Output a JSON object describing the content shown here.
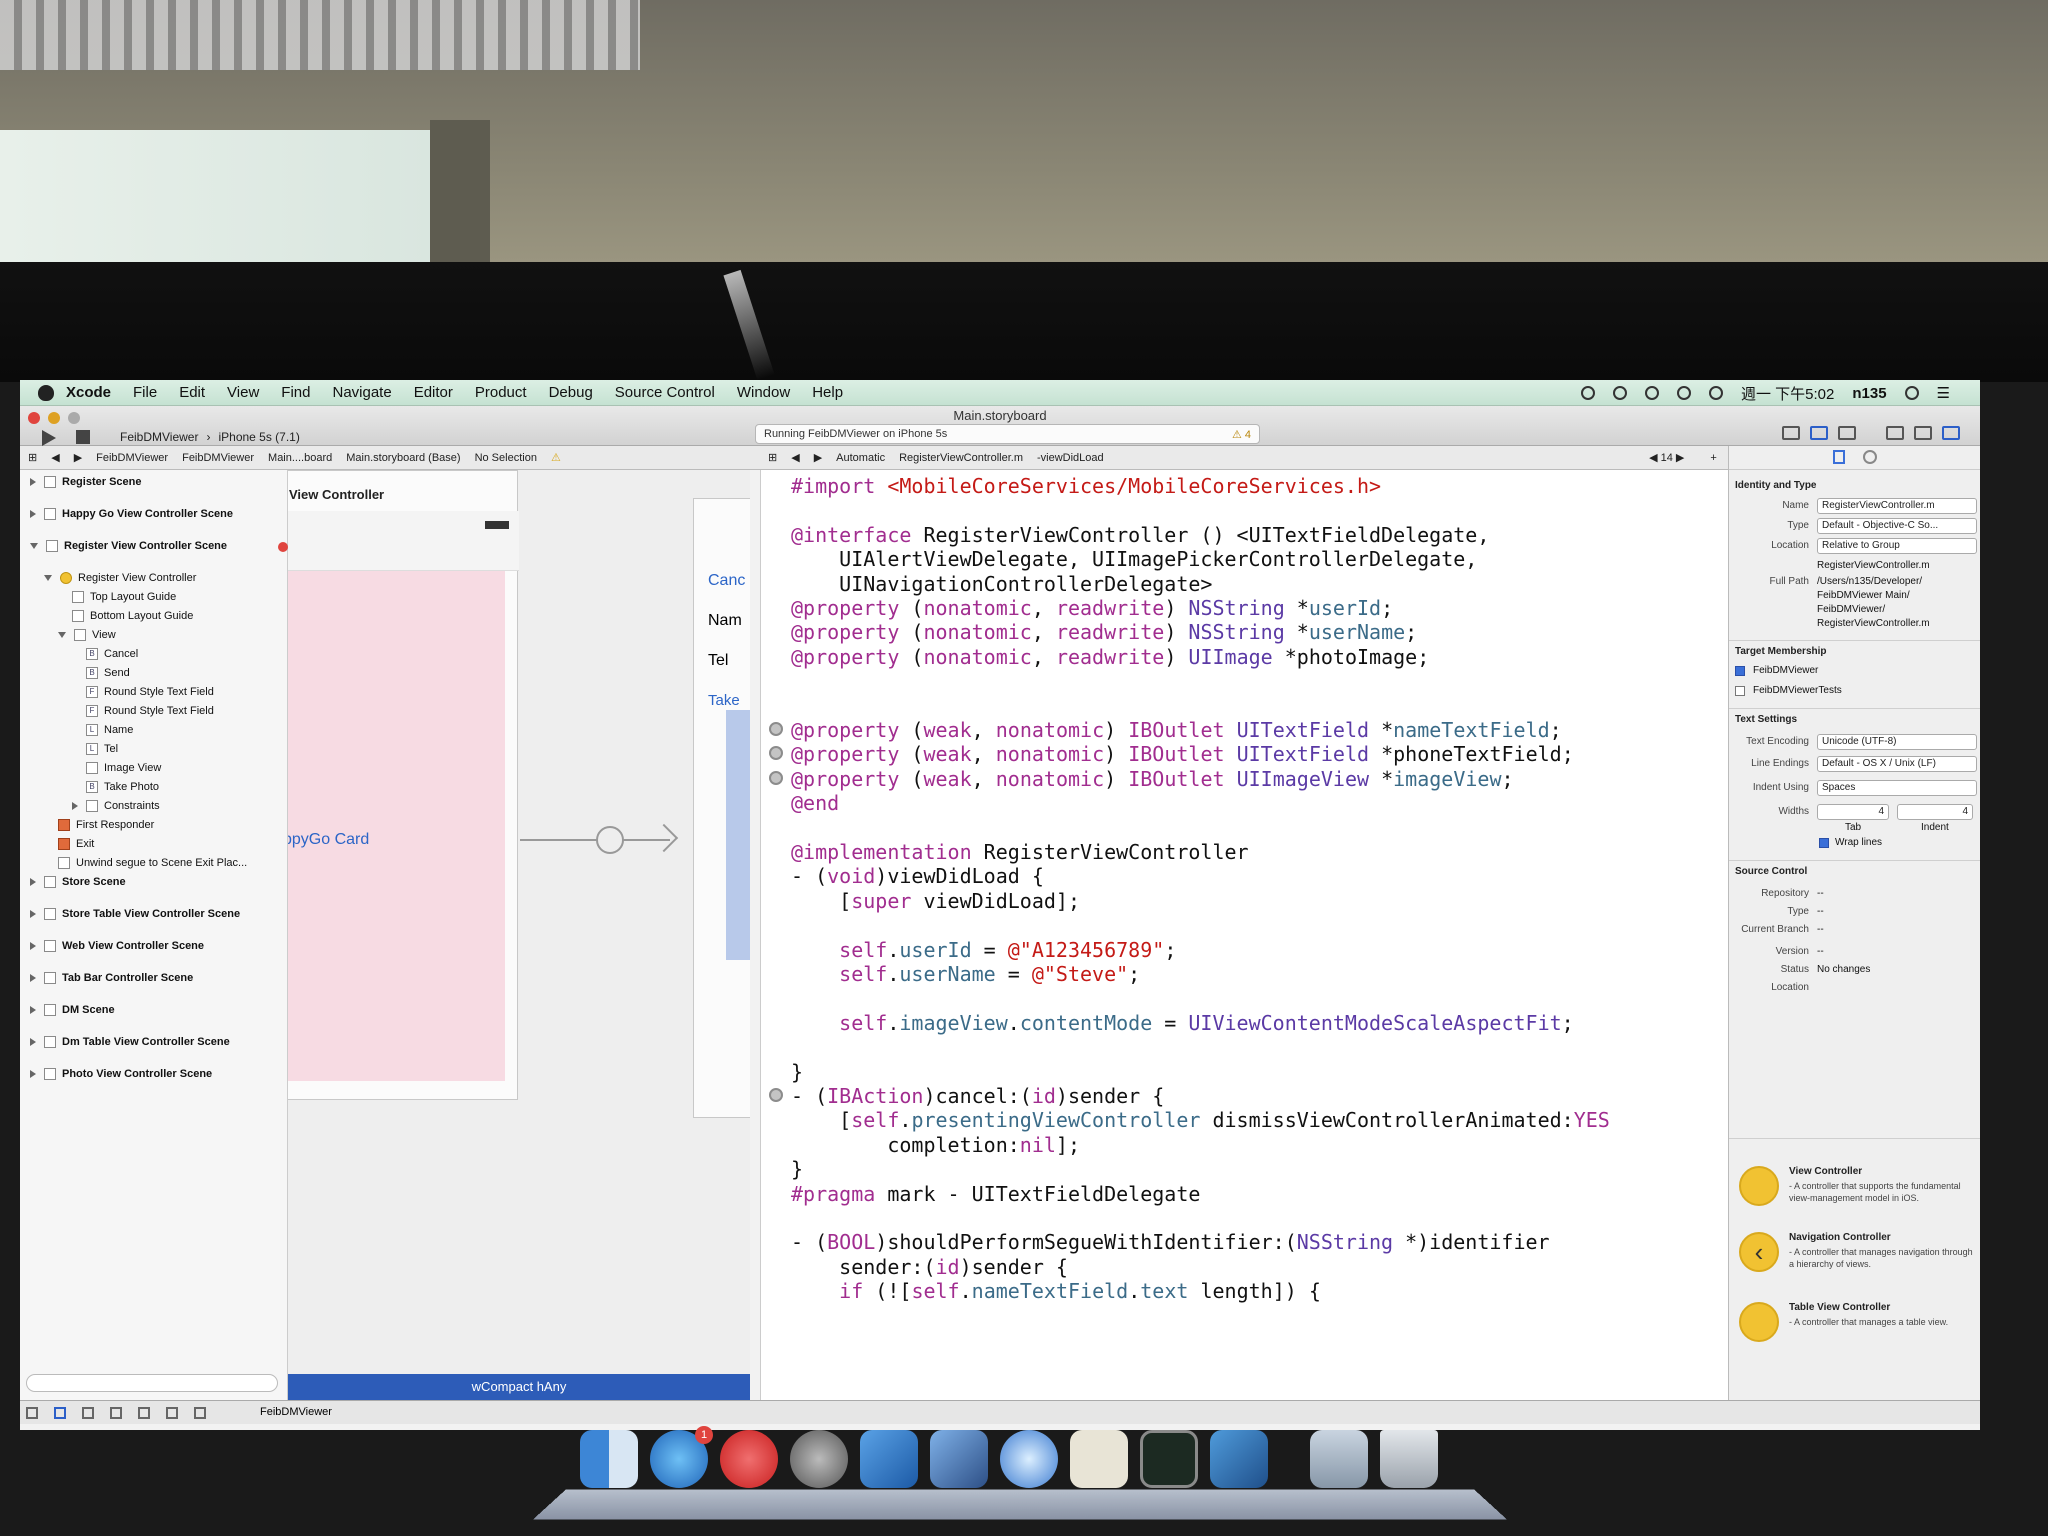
{
  "menubar": {
    "app": "Xcode",
    "items": [
      "File",
      "Edit",
      "View",
      "Find",
      "Navigate",
      "Editor",
      "Product",
      "Debug",
      "Source Control",
      "Window",
      "Help"
    ],
    "clock": "週一 下午5:02",
    "user": "n135"
  },
  "toolbar": {
    "window_title": "Main.storyboard",
    "scheme": "FeibDMViewer",
    "device": "iPhone 5s (7.1)",
    "activity": "Running FeibDMViewer on iPhone 5s",
    "warnings": "4"
  },
  "jumpbar_left": {
    "items": [
      "FeibDMViewer",
      "FeibDMViewer",
      "Main....board",
      "Main.storyboard (Base)",
      "No Selection"
    ]
  },
  "jumpbar_right": {
    "mode": "Automatic",
    "file": "RegisterViewController.m",
    "method": "-viewDidLoad",
    "counter": "14"
  },
  "navigator": {
    "rows": [
      {
        "label": "Register Scene",
        "level": 0,
        "scene": true
      },
      {
        "label": "Happy Go View Controller Scene",
        "level": 0,
        "scene": true
      },
      {
        "label": "Register View Controller Scene",
        "level": 0,
        "scene": true,
        "open": true,
        "error": true
      },
      {
        "label": "Register View Controller",
        "level": 1,
        "icon": "yellow",
        "open": true
      },
      {
        "label": "Top Layout Guide",
        "level": 2
      },
      {
        "label": "Bottom Layout Guide",
        "level": 2
      },
      {
        "label": "View",
        "level": 2,
        "open": true
      },
      {
        "label": "Cancel",
        "level": 3,
        "glyph": "B"
      },
      {
        "label": "Send",
        "level": 3,
        "glyph": "B"
      },
      {
        "label": "Round Style Text Field",
        "level": 3,
        "glyph": "F"
      },
      {
        "label": "Round Style Text Field",
        "level": 3,
        "glyph": "F"
      },
      {
        "label": "Name",
        "level": 3,
        "glyph": "L"
      },
      {
        "label": "Tel",
        "level": 3,
        "glyph": "L"
      },
      {
        "label": "Image View",
        "level": 3
      },
      {
        "label": "Take Photo",
        "level": 3,
        "glyph": "B"
      },
      {
        "label": "Constraints",
        "level": 3,
        "closed": true
      },
      {
        "label": "First Responder",
        "level": 1,
        "icon": "orange"
      },
      {
        "label": "Exit",
        "level": 1,
        "icon": "orange"
      },
      {
        "label": "Unwind segue to Scene Exit Plac...",
        "level": 1
      },
      {
        "label": "Store Scene",
        "level": 0,
        "scene": true
      },
      {
        "label": "Store Table View Controller Scene",
        "level": 0,
        "scene": true
      },
      {
        "label": "Web View Controller Scene",
        "level": 0,
        "scene": true
      },
      {
        "label": "Tab Bar Controller Scene",
        "level": 0,
        "scene": true
      },
      {
        "label": "DM Scene",
        "level": 0,
        "scene": true
      },
      {
        "label": "Dm Table View Controller Scene",
        "level": 0,
        "scene": true
      },
      {
        "label": "Photo View Controller Scene",
        "level": 0,
        "scene": true
      }
    ]
  },
  "canvas": {
    "vc_title": "View Controller",
    "happygo_label": "ppyGo Card",
    "vc2_cancel": "Canc",
    "vc2_name": "Nam",
    "vc2_tel": "Tel",
    "vc2_take": "Take",
    "size_class": "wCompact hAny"
  },
  "code": {
    "lines": [
      {
        "t": "#import <MobileCoreServices/MobileCoreServices.h>"
      },
      {
        "t": ""
      },
      {
        "t": "@interface RegisterViewController () <UITextFieldDelegate,"
      },
      {
        "t": "    UIAlertViewDelegate, UIImagePickerControllerDelegate,"
      },
      {
        "t": "    UINavigationControllerDelegate>"
      },
      {
        "t": "@property (nonatomic, readwrite) NSString *userId;"
      },
      {
        "t": "@property (nonatomic, readwrite) NSString *userName;"
      },
      {
        "t": "@property (nonatomic, readwrite) UIImage *photoImage;"
      },
      {
        "t": ""
      },
      {
        "t": ""
      },
      {
        "t": "@property (weak, nonatomic) IBOutlet UITextField *nameTextField;",
        "dot": true
      },
      {
        "t": "@property (weak, nonatomic) IBOutlet UITextField *phoneTextField;",
        "dot": true
      },
      {
        "t": "@property (weak, nonatomic) IBOutlet UIImageView *imageView;",
        "dot": true
      },
      {
        "t": "@end"
      },
      {
        "t": ""
      },
      {
        "t": "@implementation RegisterViewController"
      },
      {
        "t": "- (void)viewDidLoad {"
      },
      {
        "t": "    [super viewDidLoad];"
      },
      {
        "t": ""
      },
      {
        "t": "    self.userId = @\"A123456789\";"
      },
      {
        "t": "    self.userName = @\"Steve\";"
      },
      {
        "t": ""
      },
      {
        "t": "    self.imageView.contentMode = UIViewContentModeScaleAspectFit;"
      },
      {
        "t": ""
      },
      {
        "t": "}"
      },
      {
        "t": "- (IBAction)cancel:(id)sender {",
        "dot": true
      },
      {
        "t": "    [self.presentingViewController dismissViewControllerAnimated:YES"
      },
      {
        "t": "        completion:nil];"
      },
      {
        "t": "}"
      },
      {
        "t": "#pragma mark - UITextFieldDelegate"
      },
      {
        "t": ""
      },
      {
        "t": "- (BOOL)shouldPerformSegueWithIdentifier:(NSString *)identifier"
      },
      {
        "t": "    sender:(id)sender {"
      },
      {
        "t": "    if (![self.nameTextField.text length]) {"
      }
    ]
  },
  "inspector": {
    "identity_header": "Identity and Type",
    "name_label": "Name",
    "name_value": "RegisterViewController.m",
    "type_label": "Type",
    "type_value": "Default - Objective-C So...",
    "location_label": "Location",
    "location_value": "Relative to Group",
    "location_file": "RegisterViewController.m",
    "fullpath_label": "Full Path",
    "fullpath_lines": [
      "/Users/n135/Developer/",
      "FeibDMViewer Main/",
      "FeibDMViewer/",
      "RegisterViewController.m"
    ],
    "target_header": "Target Membership",
    "targets": [
      {
        "name": "FeibDMViewer",
        "checked": true
      },
      {
        "name": "FeibDMViewerTests",
        "checked": false
      }
    ],
    "text_header": "Text Settings",
    "encoding_label": "Text Encoding",
    "encoding_value": "Unicode (UTF-8)",
    "endings_label": "Line Endings",
    "endings_value": "Default - OS X / Unix (LF)",
    "indent_label": "Indent Using",
    "indent_value": "Spaces",
    "widths_label": "Widths",
    "tab_value": "4",
    "indent_width_value": "4",
    "tab_caption": "Tab",
    "indent_caption": "Indent",
    "wrap_label": "Wrap lines",
    "source_header": "Source Control",
    "repository_label": "Repository",
    "repository_value": "--",
    "sc_type_label": "Type",
    "sc_type_value": "--",
    "branch_label": "Current Branch",
    "branch_value": "--",
    "version_label": "Version",
    "version_value": "--",
    "status_label": "Status",
    "status_value": "No changes",
    "sc_location_label": "Location",
    "library": [
      {
        "title": "View Controller",
        "desc": "- A controller that supports the fundamental view-management model in iOS."
      },
      {
        "title": "Navigation Controller",
        "desc": "- A controller that manages navigation through a hierarchy of views."
      },
      {
        "title": "Table View Controller",
        "desc": "- A controller that manages a table view."
      }
    ]
  },
  "debug": {
    "target": "FeibDMViewer"
  },
  "dock": {
    "badge": "1"
  }
}
